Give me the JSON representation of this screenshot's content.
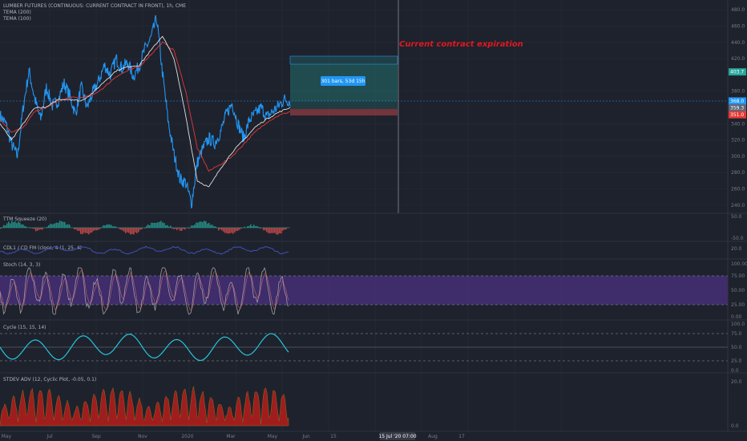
{
  "colors": {
    "background": "#1e222d",
    "grid": "#2a2e39",
    "price": "#2196f3",
    "tema200": "#e53935",
    "tema100": "#e0e0e0",
    "squeeze_pos": "#26a69a",
    "squeeze_neg": "#ef5350",
    "rsi": "#3f51b5",
    "stoch": "#9e9e9e",
    "stoch_band": "#673ab7",
    "cycle": "#26c6da",
    "stdev_fill": "#b71c1c",
    "stdev_line": "#8d6e1a",
    "target_box": "#26a69a",
    "stop_box": "#ef5350",
    "annotation": "#e0181f"
  },
  "price_pane": {
    "title": "LUMBER FUTURES (CONTINUOUS: CURRENT CONTRACT IN FRONT), 1h, CME",
    "legend": [
      "TEMA (200)",
      "TEMA (100)"
    ],
    "annotation": "Current contract expiration",
    "position_label": "301 bars, 53d 15h",
    "y_ticks": [
      "480.0",
      "460.0",
      "440.0",
      "420.0",
      "380.0",
      "340.0",
      "320.0",
      "300.0",
      "280.0",
      "260.0",
      "240.0"
    ],
    "price_tags": [
      {
        "label": "403.7",
        "value": 403.7,
        "color": "#26a69a"
      },
      {
        "label": "368.0",
        "value": 368.0,
        "color": "#2196f3"
      },
      {
        "label": "359.3",
        "value": 359.3,
        "color": "#5d6675"
      },
      {
        "label": "351.0",
        "value": 351.0,
        "color": "#e53935"
      }
    ],
    "ylim": [
      230,
      492
    ]
  },
  "indicators": {
    "squeeze": {
      "label": "TTM Squeeze (20)",
      "ticks": [
        "50.0",
        "-50.0"
      ]
    },
    "rsi": {
      "label": "CDL1 / CD FM (close, 4 (1, 25, 4)",
      "ticks": [
        "20.0"
      ]
    },
    "stoch": {
      "label": "Stoch (14, 3, 3)",
      "ticks": [
        "100.00",
        "75.00",
        "50.00",
        "25.00",
        "0.00"
      ]
    },
    "cycle": {
      "label": "Cycle (15, 15, 14)",
      "ticks": [
        "100.0",
        "75.0",
        "50.0",
        "25.0",
        "0.0"
      ]
    },
    "stdev": {
      "label": "STDEV ADV (12, Cyclic Plot, -0.05, 0.1)",
      "ticks": [
        "20.0",
        "0.0"
      ]
    }
  },
  "x_axis": {
    "labels": [
      "May",
      "Jul",
      "Sep",
      "Nov",
      "2020",
      "Mar",
      "May",
      "Jun",
      "15",
      "Jul",
      "Aug",
      "17"
    ],
    "crosshair_label": "15 Jul '20   07:00"
  },
  "chart_data": [
    {
      "type": "line",
      "title": "LUMBER FUTURES (CONTINUOUS: CURRENT CONTRACT IN FRONT), 1h, CME",
      "x_range": [
        0,
        100
      ],
      "ylim": [
        230,
        492
      ],
      "series": [
        {
          "name": "Price",
          "x": [
            0,
            2,
            4,
            6,
            8,
            10,
            12,
            14,
            16,
            18,
            20,
            22,
            24,
            26,
            28,
            30,
            32,
            34,
            36,
            38,
            40,
            42,
            44,
            46,
            48,
            50,
            52,
            54,
            56,
            58,
            60,
            62,
            64,
            66,
            68,
            70,
            72,
            74,
            76,
            78,
            80,
            82,
            84,
            86,
            88,
            90,
            92,
            94,
            96,
            98,
            100
          ],
          "values": [
            350,
            340,
            315,
            300,
            360,
            405,
            370,
            345,
            385,
            362,
            368,
            390,
            375,
            352,
            385,
            360,
            378,
            392,
            412,
            400,
            420,
            408,
            415,
            398,
            412,
            432,
            445,
            470,
            402,
            342,
            302,
            272,
            268,
            242,
            292,
            310,
            322,
            316,
            330,
            352,
            365,
            340,
            322,
            345,
            352,
            360,
            348,
            355,
            362,
            370,
            368
          ]
        },
        {
          "name": "TEMA (200)",
          "x": [
            0,
            4,
            8,
            12,
            16,
            20,
            24,
            28,
            32,
            36,
            40,
            44,
            48,
            52,
            56,
            60,
            64,
            68,
            72,
            76,
            80,
            84,
            88,
            92,
            96,
            100
          ],
          "values": [
            345,
            330,
            335,
            355,
            360,
            368,
            372,
            372,
            375,
            385,
            398,
            405,
            410,
            425,
            440,
            430,
            380,
            310,
            282,
            290,
            300,
            315,
            330,
            342,
            350,
            355
          ]
        },
        {
          "name": "TEMA (100)",
          "x": [
            0,
            4,
            8,
            12,
            16,
            20,
            24,
            28,
            32,
            36,
            40,
            44,
            48,
            52,
            56,
            60,
            64,
            68,
            72,
            76,
            80,
            84,
            88,
            92,
            96,
            100
          ],
          "values": [
            340,
            320,
            340,
            360,
            360,
            370,
            370,
            368,
            378,
            392,
            405,
            410,
            412,
            430,
            448,
            420,
            350,
            270,
            262,
            285,
            305,
            320,
            336,
            346,
            354,
            360
          ]
        }
      ]
    }
  ]
}
